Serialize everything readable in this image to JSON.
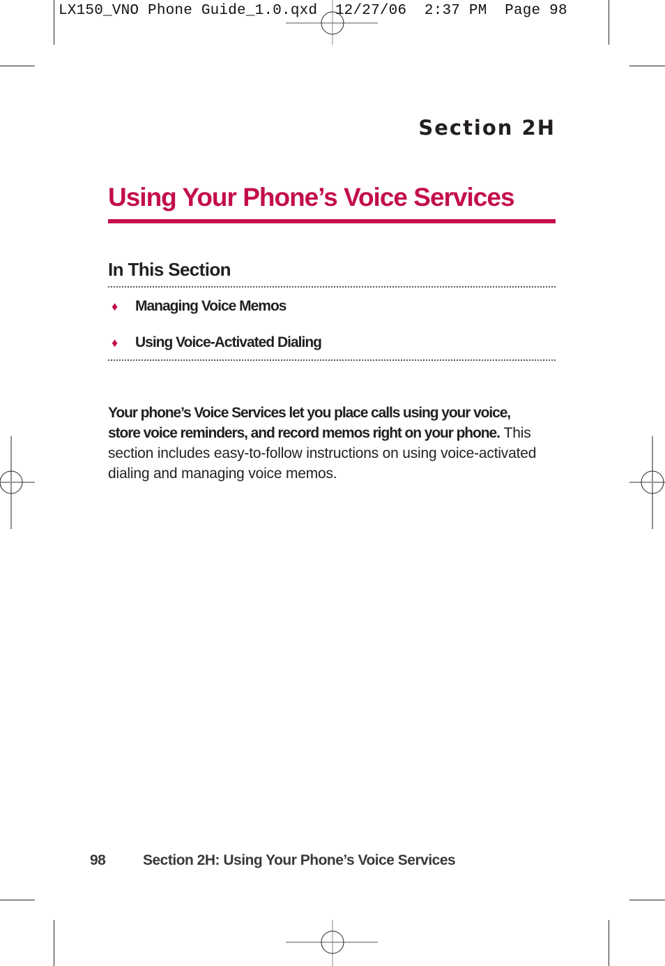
{
  "slug": {
    "filename": "LX150_VNO Phone Guide_1.0.qxd",
    "date": "12/27/06",
    "time": "2:37 PM",
    "page_label": "Page 98"
  },
  "header": {
    "section_label": "Section 2H"
  },
  "title": "Using Your Phone’s Voice Services",
  "accent_color": "#c30d4d",
  "in_this_section": {
    "heading": "In This Section",
    "items": [
      {
        "bullet": "♦",
        "label": "Managing Voice Memos"
      },
      {
        "bullet": "♦",
        "label": "Using Voice-Activated Dialing"
      }
    ]
  },
  "intro": {
    "lead": "Your phone’s Voice Services let you place calls using your voice, store voice reminders, and record memos right on your phone.",
    "body": "This section includes easy-to-follow instructions on using voice-activated dialing and managing voice memos."
  },
  "footer": {
    "page_number": "98",
    "running_title": "Section 2H: Using Your Phone’s Voice Services"
  }
}
